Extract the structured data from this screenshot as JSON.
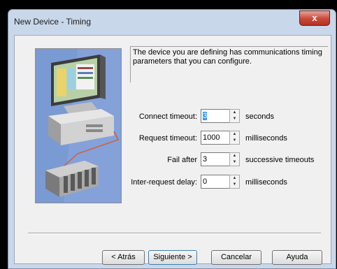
{
  "window": {
    "title": "New Device - Timing",
    "close_glyph": "x"
  },
  "description": "The device you are defining has communications timing parameters that you can configure.",
  "fields": [
    {
      "label": "Connect timeout:",
      "value": "3",
      "unit": "seconds"
    },
    {
      "label": "Request timeout:",
      "value": "1000",
      "unit": "milliseconds"
    },
    {
      "label": "Fail after",
      "value": "3",
      "unit": "successive timeouts"
    },
    {
      "label": "Inter-request delay:",
      "value": "0",
      "unit": "milliseconds"
    }
  ],
  "buttons": {
    "back": "< Atrás",
    "next": "Siguiente >",
    "cancel": "Cancelar",
    "help": "Ayuda"
  },
  "colors": {
    "selection": "#3399ff",
    "art_bg": "#7a9ad3",
    "close": "#c8493a"
  }
}
